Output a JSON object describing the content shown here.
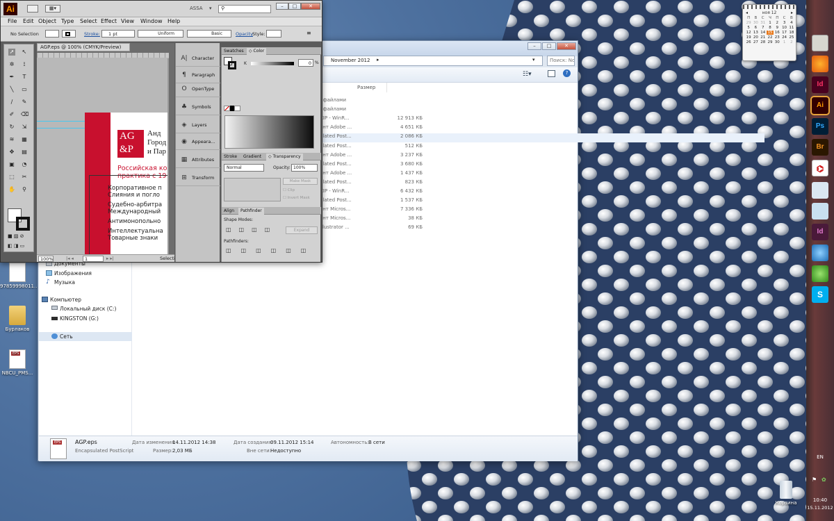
{
  "colors": {
    "ai_accent": "#ff9a00",
    "ag_red": "#c8102e",
    "ps_blue": "#31a8ff",
    "id_pink": "#ff3366",
    "br_orange": "#ec8f21"
  },
  "illustrator": {
    "logo": "Ai",
    "workspace": "ASSA",
    "menu": [
      "File",
      "Edit",
      "Object",
      "Type",
      "Select",
      "Effect",
      "View",
      "Window",
      "Help"
    ],
    "control": {
      "selection": "No Selection",
      "stroke_label": "Stroke:",
      "stroke_value": "1 pt",
      "uniform": "Uniform",
      "basic": "Basic",
      "opacity_label": "Opacity",
      "style_label": "Style:"
    },
    "doc_tab": "AGP.eps @ 100% (CMYK/Preview)",
    "zoom": "100%",
    "page": "1",
    "status": "Selectio",
    "artwork": {
      "logo_top": "AG",
      "logo_bottom": "&P",
      "heading_lines": [
        "Анд",
        "Город",
        "и Пар"
      ],
      "red_lines": [
        "Российская ко",
        "практика с 19"
      ],
      "bullets": [
        "Корпоративное п",
        "Слияния и погло",
        "Судебно-арбитра",
        "Международный",
        "Антимонопольно",
        "Интеллектуальна",
        "Товарные знаки"
      ]
    },
    "panel_strip": [
      "Character",
      "Paragraph",
      "OpenType",
      "Symbols",
      "Layers",
      "Appeara...",
      "Attributes",
      "Transform"
    ],
    "swatches": {
      "tabs": [
        "Swatches",
        "Color"
      ],
      "k_label": "K",
      "k_value": "0",
      "pct": "%"
    },
    "transparency": {
      "tabs": [
        "Stroke",
        "Gradient",
        "Transparency"
      ],
      "blend": "Normal",
      "opacity_label": "Opacity:",
      "opacity_value": "100%",
      "make_mask": "Make Mask",
      "clip": "Clip",
      "invert": "Invert Mask"
    },
    "pathfinder": {
      "tabs": [
        "Align",
        "Pathfinder"
      ],
      "shape_modes": "Shape Modes:",
      "expand": "Expand",
      "pathfinders": "Pathfinders:"
    }
  },
  "explorer": {
    "breadcrumb": "November 2012",
    "search_placeholder": "Поиск: Novembe...",
    "size_header": "Размер",
    "rows": [
      {
        "type": ": файлами",
        "size": ""
      },
      {
        "type": ": файлами",
        "size": ""
      },
      {
        "type": "ZIP - WinR...",
        "size": "12 913 КБ"
      },
      {
        "type": "ент Adobe ...",
        "size": "4 651 КБ"
      },
      {
        "type": "ulated Post...",
        "size": "2 086 КБ"
      },
      {
        "type": "ulated Post...",
        "size": "512 КБ"
      },
      {
        "type": "ент Adobe ...",
        "size": "3 237 КБ"
      },
      {
        "type": "ulated Post...",
        "size": "3 680 КБ"
      },
      {
        "type": "ент Adobe ...",
        "size": "1 437 КБ"
      },
      {
        "type": "ulated Post...",
        "size": "823 КБ"
      },
      {
        "type": "ZIP - WinR...",
        "size": "6 432 КБ"
      },
      {
        "type": "ulated Post...",
        "size": "1 537 КБ"
      },
      {
        "type": "ент Micros...",
        "size": "7 336 КБ"
      },
      {
        "type": "ент Micros...",
        "size": "38 КБ"
      },
      {
        "type": "Illustrator ...",
        "size": "69 КБ"
      }
    ],
    "nav": {
      "documents": "Документы",
      "images": "Изображения",
      "music": "Музыка",
      "computer": "Компьютер",
      "local_disk": "Локальный диск (C:)",
      "kingston": "KINGSTON (G:)",
      "network": "Сеть"
    },
    "details": {
      "filename": "AGP.eps",
      "filetype": "Encapsulated PostScript",
      "modified_label": "Дата изменения:",
      "modified_value": "14.11.2012 14:38",
      "size_label": "Размер:",
      "size_value": "2,03 МБ",
      "created_label": "Дата создания:",
      "created_value": "09.11.2012 15:14",
      "offline_label": "Вне сети:",
      "offline_value": "Недоступно",
      "availability_label": "Автономность:",
      "availability_value": "В сети",
      "eps_badge": "EPS"
    }
  },
  "desktop": {
    "icons": [
      {
        "label": "97859998011..."
      },
      {
        "label": "Бурлаков"
      },
      {
        "label": "NBCU_PMS..."
      },
      {
        "label": "Корзина"
      }
    ]
  },
  "calendar": {
    "month": "ноя 12",
    "weekdays": [
      "П",
      "В",
      "С",
      "Ч",
      "П",
      "С",
      "В"
    ],
    "days": [
      "29",
      "30",
      "31",
      "1",
      "2",
      "3",
      "4",
      "5",
      "6",
      "7",
      "8",
      "9",
      "10",
      "11",
      "12",
      "13",
      "14",
      "15",
      "16",
      "17",
      "18",
      "19",
      "20",
      "21",
      "22",
      "23",
      "24",
      "25",
      "26",
      "27",
      "28",
      "29",
      "30",
      "1",
      "2"
    ],
    "today": "15"
  },
  "tray": {
    "lang": "EN",
    "time": "10:40",
    "date": "15.11.2012"
  },
  "dock": [
    "Ai",
    "Ps",
    "Br",
    "Id"
  ]
}
